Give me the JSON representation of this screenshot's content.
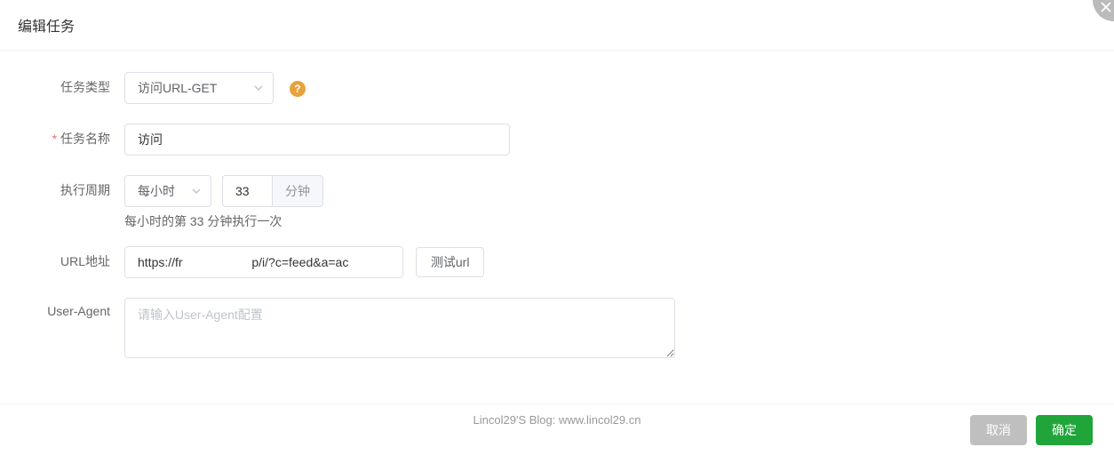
{
  "modal": {
    "title": "编辑任务"
  },
  "form": {
    "taskType": {
      "label": "任务类型",
      "selected": "访问URL-GET"
    },
    "taskName": {
      "label": "任务名称",
      "value": "访问"
    },
    "cycle": {
      "label": "执行周期",
      "unitSelected": "每小时",
      "minuteValue": "33",
      "minuteSuffix": "分钟",
      "hint": "每小时的第 33 分钟执行一次"
    },
    "url": {
      "label": "URL地址",
      "value": "https://fr                    p/i/?c=feed&a=ac",
      "testButton": "测试url"
    },
    "userAgent": {
      "label": "User-Agent",
      "placeholder": "请输入User-Agent配置"
    }
  },
  "footer": {
    "watermark": "Lincol29'S Blog:   www.lincol29.cn",
    "cancel": "取消",
    "confirm": "确定"
  },
  "helpGlyph": "?"
}
